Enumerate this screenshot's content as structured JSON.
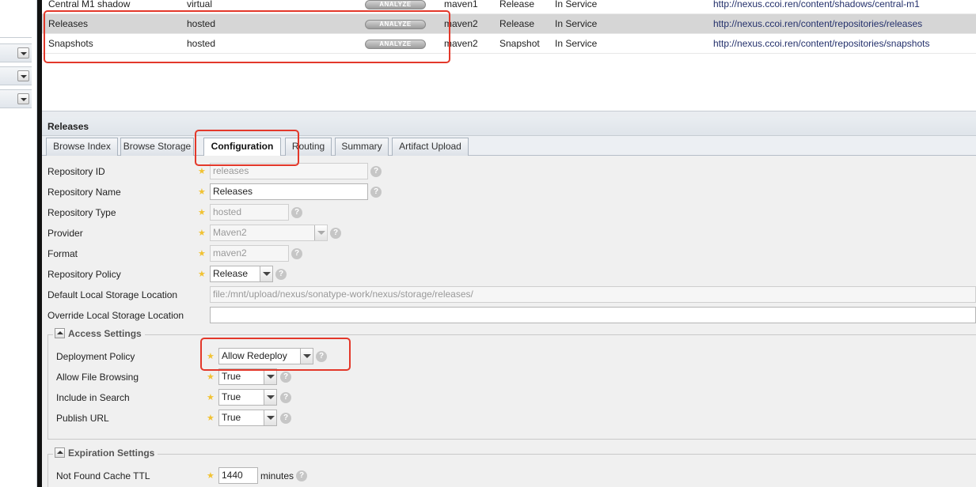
{
  "grid": {
    "rows": [
      {
        "name": "Central M1 shadow",
        "type": "hosted_virtual",
        "type_text": "virtual",
        "analyze": "ANALYZE",
        "format": "maven1",
        "policy": "Release",
        "status": "In Service",
        "url": "http://nexus.ccoi.ren/content/shadows/central-m1"
      },
      {
        "name": "Releases",
        "type_text": "hosted",
        "analyze": "ANALYZE",
        "format": "maven2",
        "policy": "Release",
        "status": "In Service",
        "url": "http://nexus.ccoi.ren/content/repositories/releases"
      },
      {
        "name": "Snapshots",
        "type_text": "hosted",
        "analyze": "ANALYZE",
        "format": "maven2",
        "policy": "Snapshot",
        "status": "In Service",
        "url": "http://nexus.ccoi.ren/content/repositories/snapshots"
      }
    ]
  },
  "panel": {
    "title": "Releases",
    "tabs": [
      "Browse Index",
      "Browse Storage",
      "Configuration",
      "Routing",
      "Summary",
      "Artifact Upload"
    ]
  },
  "form": {
    "repository_id": {
      "label": "Repository ID",
      "value": "releases"
    },
    "repository_name": {
      "label": "Repository Name",
      "value": "Releases"
    },
    "repository_type": {
      "label": "Repository Type",
      "value": "hosted"
    },
    "provider": {
      "label": "Provider",
      "value": "Maven2"
    },
    "format": {
      "label": "Format",
      "value": "maven2"
    },
    "repository_policy": {
      "label": "Repository Policy",
      "value": "Release"
    },
    "default_storage": {
      "label": "Default Local Storage Location",
      "value": "file:/mnt/upload/nexus/sonatype-work/nexus/storage/releases/"
    },
    "override_storage": {
      "label": "Override Local Storage Location",
      "value": ""
    }
  },
  "access_settings": {
    "legend": "Access Settings",
    "deployment_policy": {
      "label": "Deployment Policy",
      "value": "Allow Redeploy"
    },
    "allow_file_browsing": {
      "label": "Allow File Browsing",
      "value": "True"
    },
    "include_in_search": {
      "label": "Include in Search",
      "value": "True"
    },
    "publish_url": {
      "label": "Publish URL",
      "value": "True"
    }
  },
  "expiration_settings": {
    "legend": "Expiration Settings",
    "not_found_cache_ttl": {
      "label": "Not Found Cache TTL",
      "value": "1440",
      "unit": "minutes"
    }
  },
  "colors": {
    "highlight": "#e3382a",
    "selected_row": "#d6d6d6",
    "required_star": "#f1c232"
  }
}
